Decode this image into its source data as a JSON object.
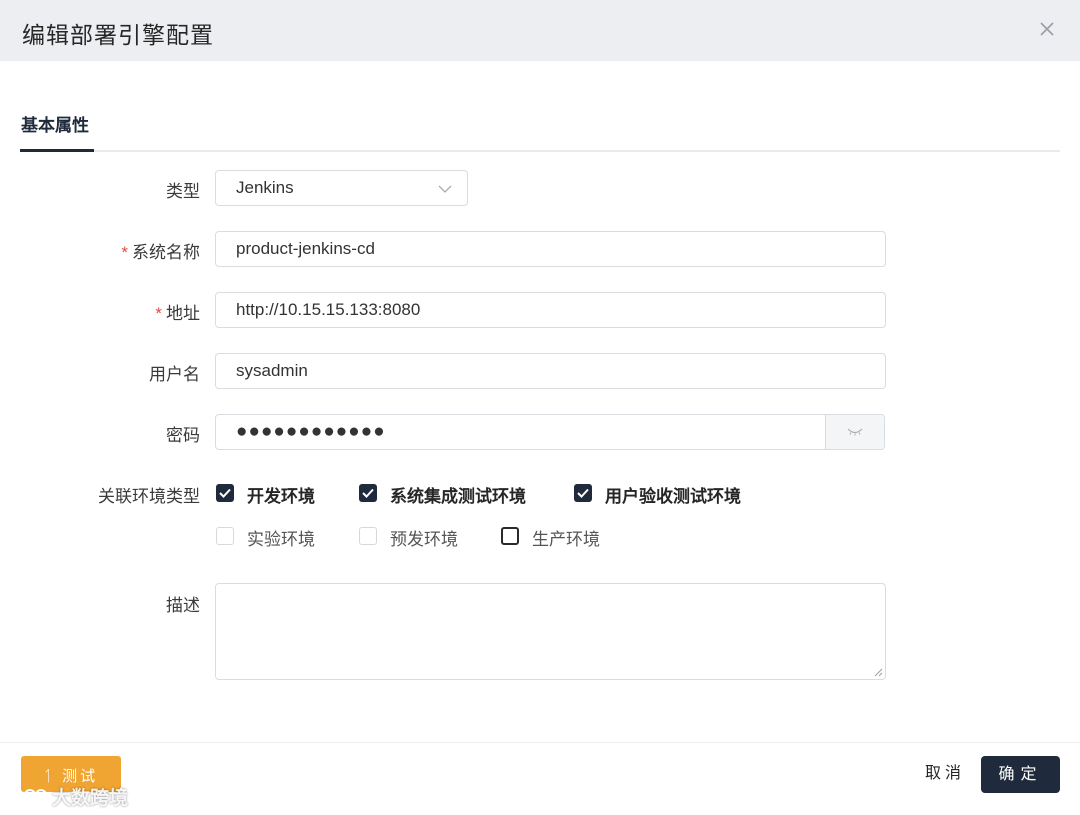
{
  "dialog": {
    "title": "编辑部署引擎配置"
  },
  "tabs": [
    {
      "label": "基本属性",
      "active": true
    }
  ],
  "form": {
    "type": {
      "label": "类型",
      "value": "Jenkins"
    },
    "system_name": {
      "label": "系统名称",
      "required": true,
      "value": "product-jenkins-cd"
    },
    "address": {
      "label": "地址",
      "required": true,
      "value": "http://10.15.15.133:8080"
    },
    "username": {
      "label": "用户名",
      "value": "sysadmin"
    },
    "password": {
      "label": "密码",
      "masked_value": "●●●●●●●●●●●●"
    },
    "env_types": {
      "label": "关联环境类型",
      "options": [
        {
          "label": "开发环境",
          "checked": true
        },
        {
          "label": "系统集成测试环境",
          "checked": true
        },
        {
          "label": "用户验收测试环境",
          "checked": true
        },
        {
          "label": "实验环境",
          "checked": false,
          "disabled": true
        },
        {
          "label": "预发环境",
          "checked": false,
          "disabled": true
        },
        {
          "label": "生产环境",
          "checked": false,
          "disabled": false
        }
      ]
    },
    "description": {
      "label": "描述",
      "value": ""
    },
    "required_mark": "*"
  },
  "footer": {
    "test_button": "测试",
    "cancel_button": "取消",
    "confirm_button": "确定"
  },
  "watermark": {
    "text": "大数跨境"
  },
  "colors": {
    "primary": "#1f2a3c",
    "test_button": "#f0a431",
    "required": "#e8493f",
    "header_bg": "#eceef1"
  }
}
